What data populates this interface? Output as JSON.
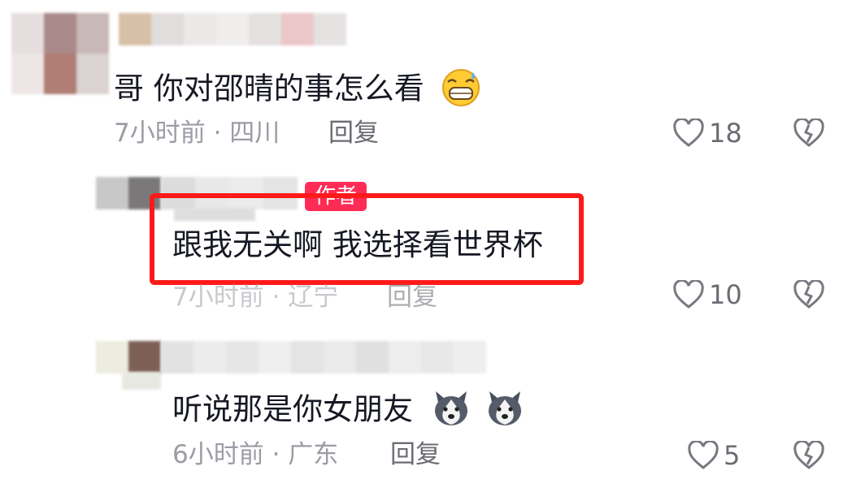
{
  "colors": {
    "highlight": "#ff1a1a",
    "author_badge": "#fe2c55",
    "meta_text": "#9b9ca4",
    "text": "#161823"
  },
  "comments": [
    {
      "text": "哥 你对邵晴的事怎么看",
      "emoji": "grinning-sweat-emoji",
      "meta": "7小时前 · 四川",
      "reply_label": "回复",
      "likes": "18"
    },
    {
      "author_badge": "作者",
      "text": "跟我无关啊 我选择看世界杯",
      "meta": "7小时前 · 辽宁",
      "reply_label": "回复",
      "likes": "10"
    },
    {
      "text": "听说那是你女朋友",
      "emoji": "husky-dog-emoji",
      "meta": "6小时前 · 广东",
      "reply_label": "回复",
      "likes": "5"
    }
  ]
}
